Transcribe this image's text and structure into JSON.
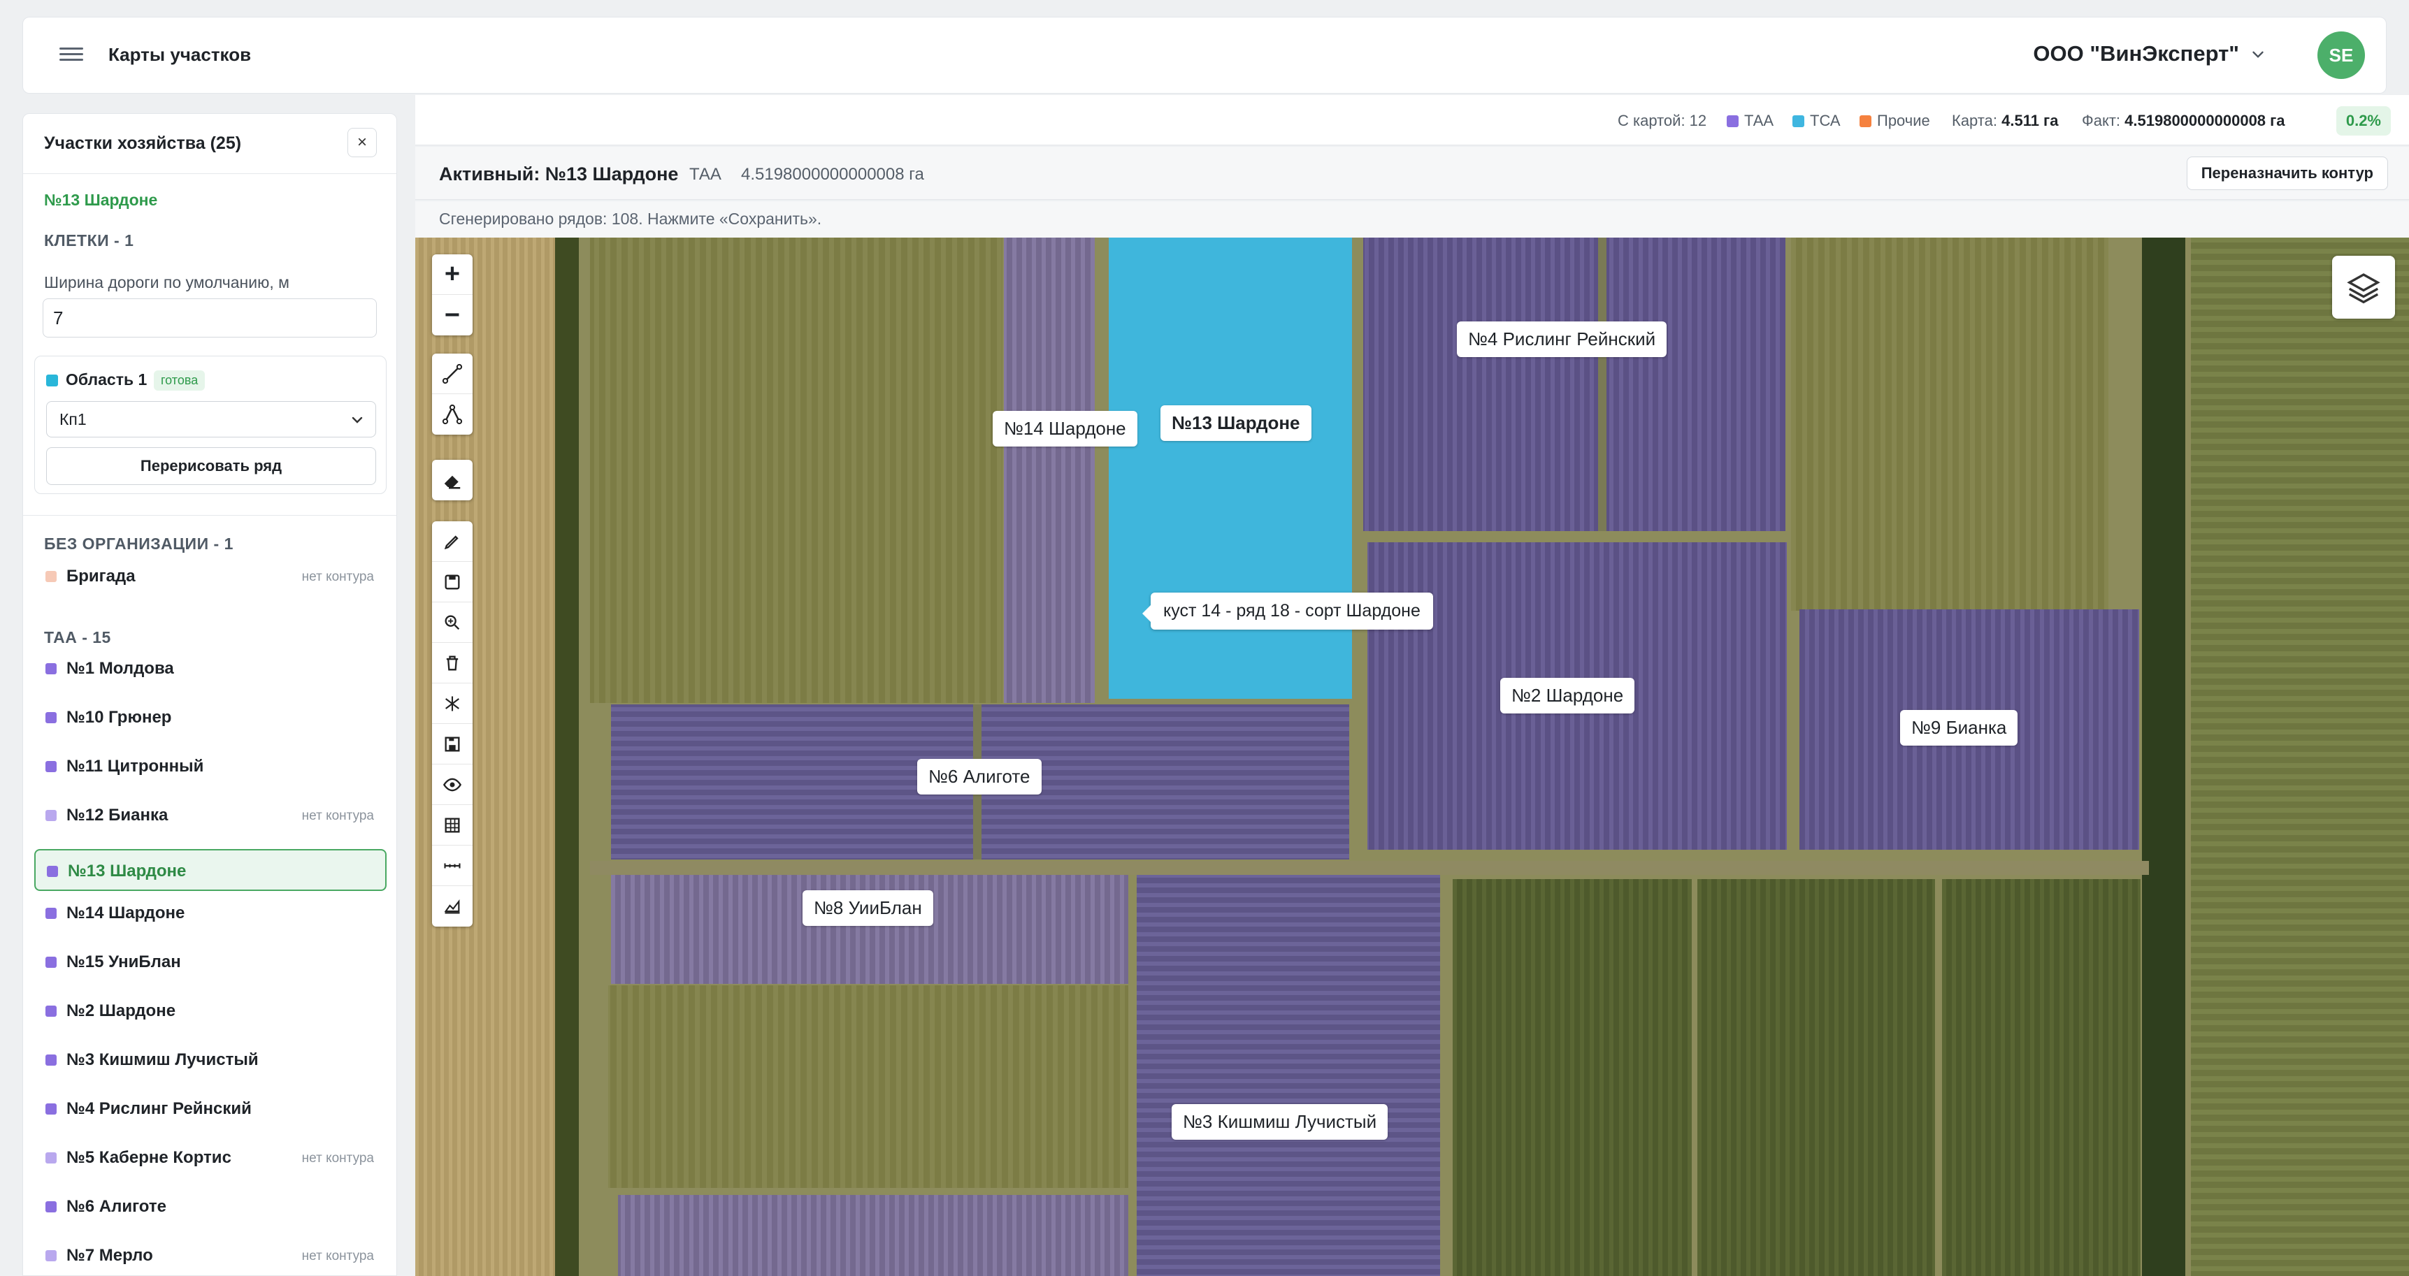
{
  "header": {
    "app_title": "Карты участков",
    "org_name": "ООО \"ВинЭксперт\"",
    "avatar_initials": "SE"
  },
  "sidebar": {
    "title": "Участки хозяйства (25)",
    "close_label": "×",
    "active_plot": "№13 Шардоне",
    "cells_section": "КЛЕТКИ - 1",
    "road_width_label": "Ширина дороги по умолчанию, м",
    "road_width_value": "7",
    "area": {
      "name": "Область 1",
      "status": "готова",
      "select_value": "Кп1",
      "redraw_label": "Перерисовать ряд"
    },
    "no_org_section": "БЕЗ ОРГАНИЗАЦИИ - 1",
    "no_org_items": [
      {
        "label": "Бригада",
        "note": "нет контура",
        "color": "#f6c9b6"
      }
    ],
    "taa_section": "ТАА - 15",
    "items": [
      {
        "label": "№1 Молдова",
        "note": "",
        "color": "#8a6fe0"
      },
      {
        "label": "№10 Грюнер",
        "note": "",
        "color": "#8a6fe0"
      },
      {
        "label": "№11 Цитронный",
        "note": "",
        "color": "#8a6fe0"
      },
      {
        "label": "№12 Бианка",
        "note": "нет контура",
        "color": "#b9a8ee"
      },
      {
        "label": "№13 Шардоне",
        "note": "",
        "color": "#8a6fe0"
      },
      {
        "label": "№14 Шардоне",
        "note": "",
        "color": "#8a6fe0"
      },
      {
        "label": "№15 УниБлан",
        "note": "",
        "color": "#8a6fe0"
      },
      {
        "label": "№2 Шардоне",
        "note": "",
        "color": "#8a6fe0"
      },
      {
        "label": "№3 Кишмиш Лучистый",
        "note": "",
        "color": "#8a6fe0"
      },
      {
        "label": "№4 Рислинг Рейнский",
        "note": "",
        "color": "#8a6fe0"
      },
      {
        "label": "№5 Каберне Кортис",
        "note": "нет контура",
        "color": "#b9a8ee"
      },
      {
        "label": "№6 Алиготе",
        "note": "",
        "color": "#8a6fe0"
      },
      {
        "label": "№7 Мерло",
        "note": "нет контура",
        "color": "#b9a8ee"
      }
    ]
  },
  "stats": {
    "with_map": "С картой: 12",
    "legend": [
      {
        "label": "ТАА",
        "color": "#8a6fe0"
      },
      {
        "label": "ТСА",
        "color": "#3fb6e0"
      },
      {
        "label": "Прочие",
        "color": "#f5813f"
      }
    ],
    "map_label": "Карта:",
    "map_value": "4.511 га",
    "fact_label": "Факт:",
    "fact_value": "4.519800000000008 га",
    "percent": "0.2%"
  },
  "active": {
    "title": "Активный: №13 Шардоне",
    "type": "ТАА",
    "area": "4.5198000000000008 га",
    "reassign_label": "Переназначить контур"
  },
  "generated_message": "Сгенерировано рядов: 108. Нажмите «Сохранить».",
  "map": {
    "labels": [
      "№4 Рислинг Рейнский",
      "№14 Шардоне",
      "№13 Шардоне",
      "№2 Шардоне",
      "№9 Бианка",
      "№6 Алиготе",
      "№8 УииБлан",
      "№3 Кишмиш Лучистый"
    ],
    "tooltip": "куст 14 - ряд 18 - сорт Шардоне",
    "zoom_in": "+",
    "zoom_out": "−"
  },
  "icons": {
    "menu": "hamburger-icon",
    "org_dropdown": "chevron-down-icon",
    "layers": "layers-icon",
    "tools": [
      "polyline-icon",
      "polygon-icon",
      "eraser-icon",
      "pencil-icon",
      "save-icon",
      "zoom-search-icon",
      "trash-icon",
      "split-icon",
      "floppy-icon",
      "eye-icon",
      "grid-icon",
      "ruler-icon",
      "area-chart-icon"
    ]
  },
  "colors": {
    "accent_green": "#2e9a4b",
    "active_plot": "#3fb6dc",
    "plot_purple": "#5b5185",
    "field_olive": "#7a7a44"
  }
}
